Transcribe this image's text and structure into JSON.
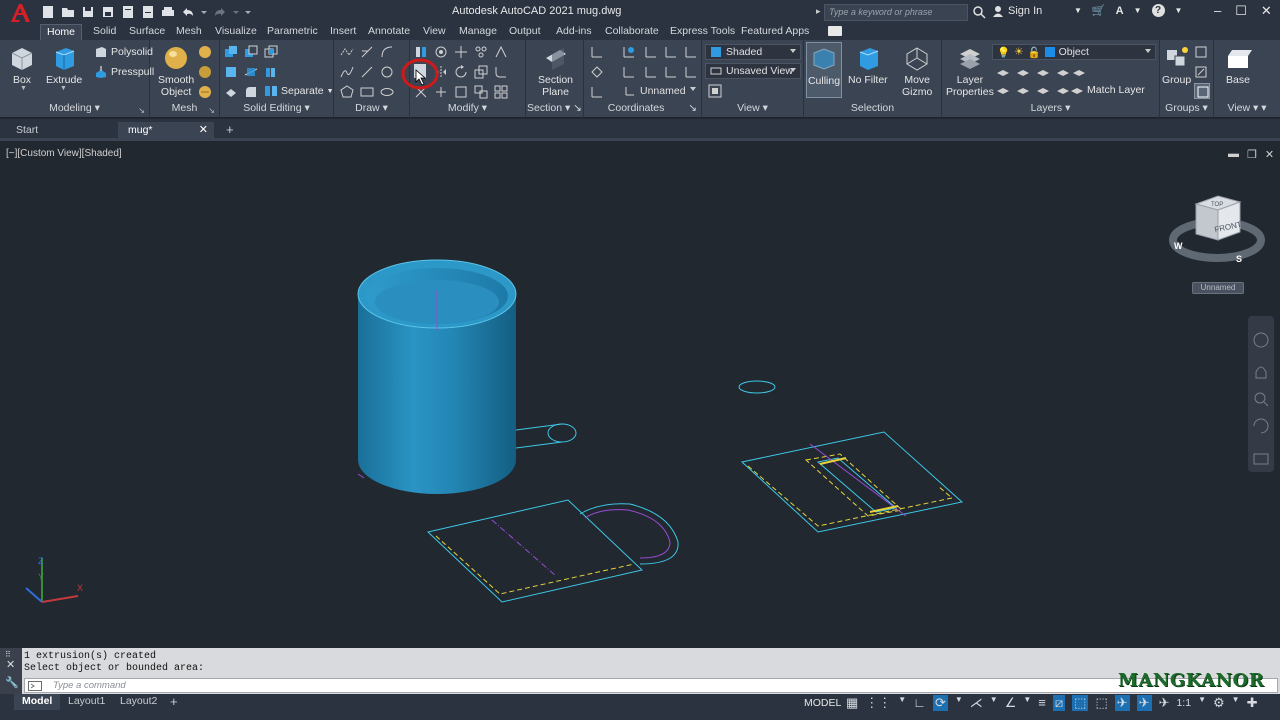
{
  "titlebar": {
    "title": "Autodesk AutoCAD 2021   mug.dwg",
    "search_placeholder": "Type a keyword or phrase",
    "signin_label": "Sign In"
  },
  "ribbon_tabs": [
    "Home",
    "Solid",
    "Surface",
    "Mesh",
    "Visualize",
    "Parametric",
    "Insert",
    "Annotate",
    "View",
    "Manage",
    "Output",
    "Add-ins",
    "Collaborate",
    "Express Tools",
    "Featured Apps"
  ],
  "ribbon": {
    "modeling": {
      "title": "Modeling",
      "box": "Box",
      "extrude": "Extrude",
      "polysolid": "Polysolid",
      "presspull": "Presspull"
    },
    "mesh": {
      "title": "Mesh",
      "smooth_object_1": "Smooth",
      "smooth_object_2": "Object"
    },
    "solid_editing": {
      "title": "Solid Editing",
      "separate": "Separate"
    },
    "draw": {
      "title": "Draw"
    },
    "modify": {
      "title": "Modify"
    },
    "section": {
      "title": "Section",
      "section_plane_1": "Section",
      "section_plane_2": "Plane"
    },
    "coordinates": {
      "title": "Coordinates",
      "ucs_dropdown": "Unnamed"
    },
    "view": {
      "title": "View",
      "visual_style": "Shaded",
      "named_view": "Unsaved View"
    },
    "selection": {
      "title": "Selection",
      "culling": "Culling",
      "no_filter": "No Filter",
      "move_gizmo_1": "Move",
      "move_gizmo_2": "Gizmo"
    },
    "layers": {
      "title": "Layers",
      "layer_properties_1": "Layer",
      "layer_properties_2": "Properties",
      "layer_dropdown": "Object",
      "match_layer": "Match Layer"
    },
    "groups": {
      "title": "Groups",
      "group": "Group"
    },
    "view2": {
      "title": "View",
      "base": "Base"
    }
  },
  "file_tabs": {
    "start": "Start",
    "drawing": "mug*"
  },
  "viewport": {
    "label": "[−][Custom View][Shaded]",
    "viewcube_face": "FRONT",
    "viewcube_top": "TOP",
    "compass_w": "W",
    "compass_s": "S",
    "ucs_name": "Unnamed",
    "axis_x": "X",
    "axis_y": "Y",
    "axis_z": "Z"
  },
  "command": {
    "history_1": "1 extrusion(s) created",
    "history_2": "Select object or bounded area:",
    "placeholder": "Type a command"
  },
  "statusbar": {
    "tabs": [
      "Model",
      "Layout1",
      "Layout2"
    ],
    "model_label": "MODEL",
    "scale": "1:1"
  },
  "watermark": "MANGKANOR",
  "colors": {
    "accent": "#1f8fd0",
    "mug": "#2a8fbd",
    "sketch": "#3ec7e6",
    "hidden": "#e6d43a",
    "highlight_circle": "#d11919"
  }
}
